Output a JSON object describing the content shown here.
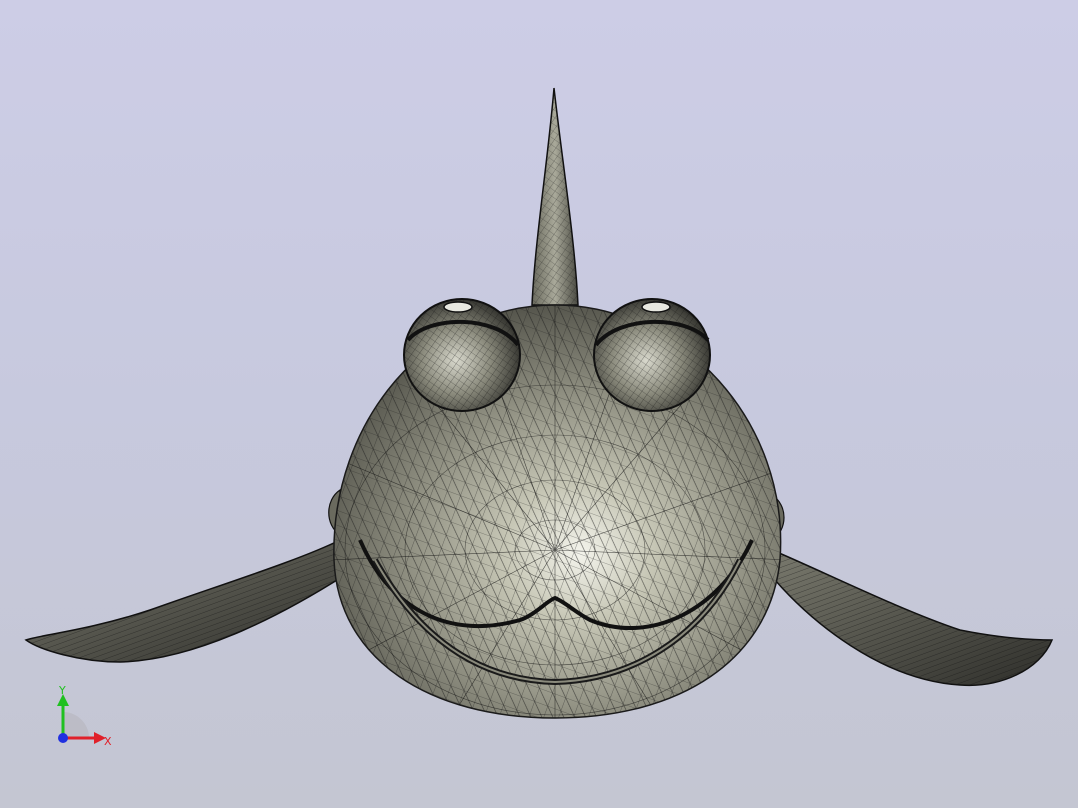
{
  "viewport": {
    "background_top": "#cdcde6",
    "background_bottom": "#c4c6d2"
  },
  "model": {
    "body_color": "#8a8a7c",
    "mesh_color": "#1a1a1a"
  },
  "axis_triad": {
    "x_label": "X",
    "y_label": "Y",
    "x_color": "#e0202a",
    "y_color": "#20c020",
    "z_color": "#2030e0"
  }
}
